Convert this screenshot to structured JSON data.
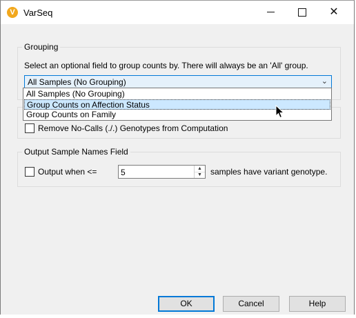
{
  "window": {
    "title": "VarSeq",
    "app_icon_glyph": "V",
    "accent": "#f2a81d"
  },
  "grouping": {
    "legend": "Grouping",
    "description": "Select an optional field to group counts by. There will always be an 'All' group.",
    "selected": "All Samples (No Grouping)",
    "options": [
      "All Samples (No Grouping)",
      "Group Counts on Affection Status",
      "Group Counts on Family"
    ],
    "highlighted_index": 1
  },
  "nocalls": {
    "label": "Remove No-Calls (./.) Genotypes from Computation",
    "checked": false
  },
  "output": {
    "legend": "Output Sample Names Field",
    "checkbox_label": "Output when <=",
    "value": "5",
    "suffix": "samples have variant genotype.",
    "checked": false
  },
  "buttons": {
    "ok": "OK",
    "cancel": "Cancel",
    "help": "Help"
  },
  "colors": {
    "selection": "#cce8ff",
    "focus": "#0078d7"
  }
}
